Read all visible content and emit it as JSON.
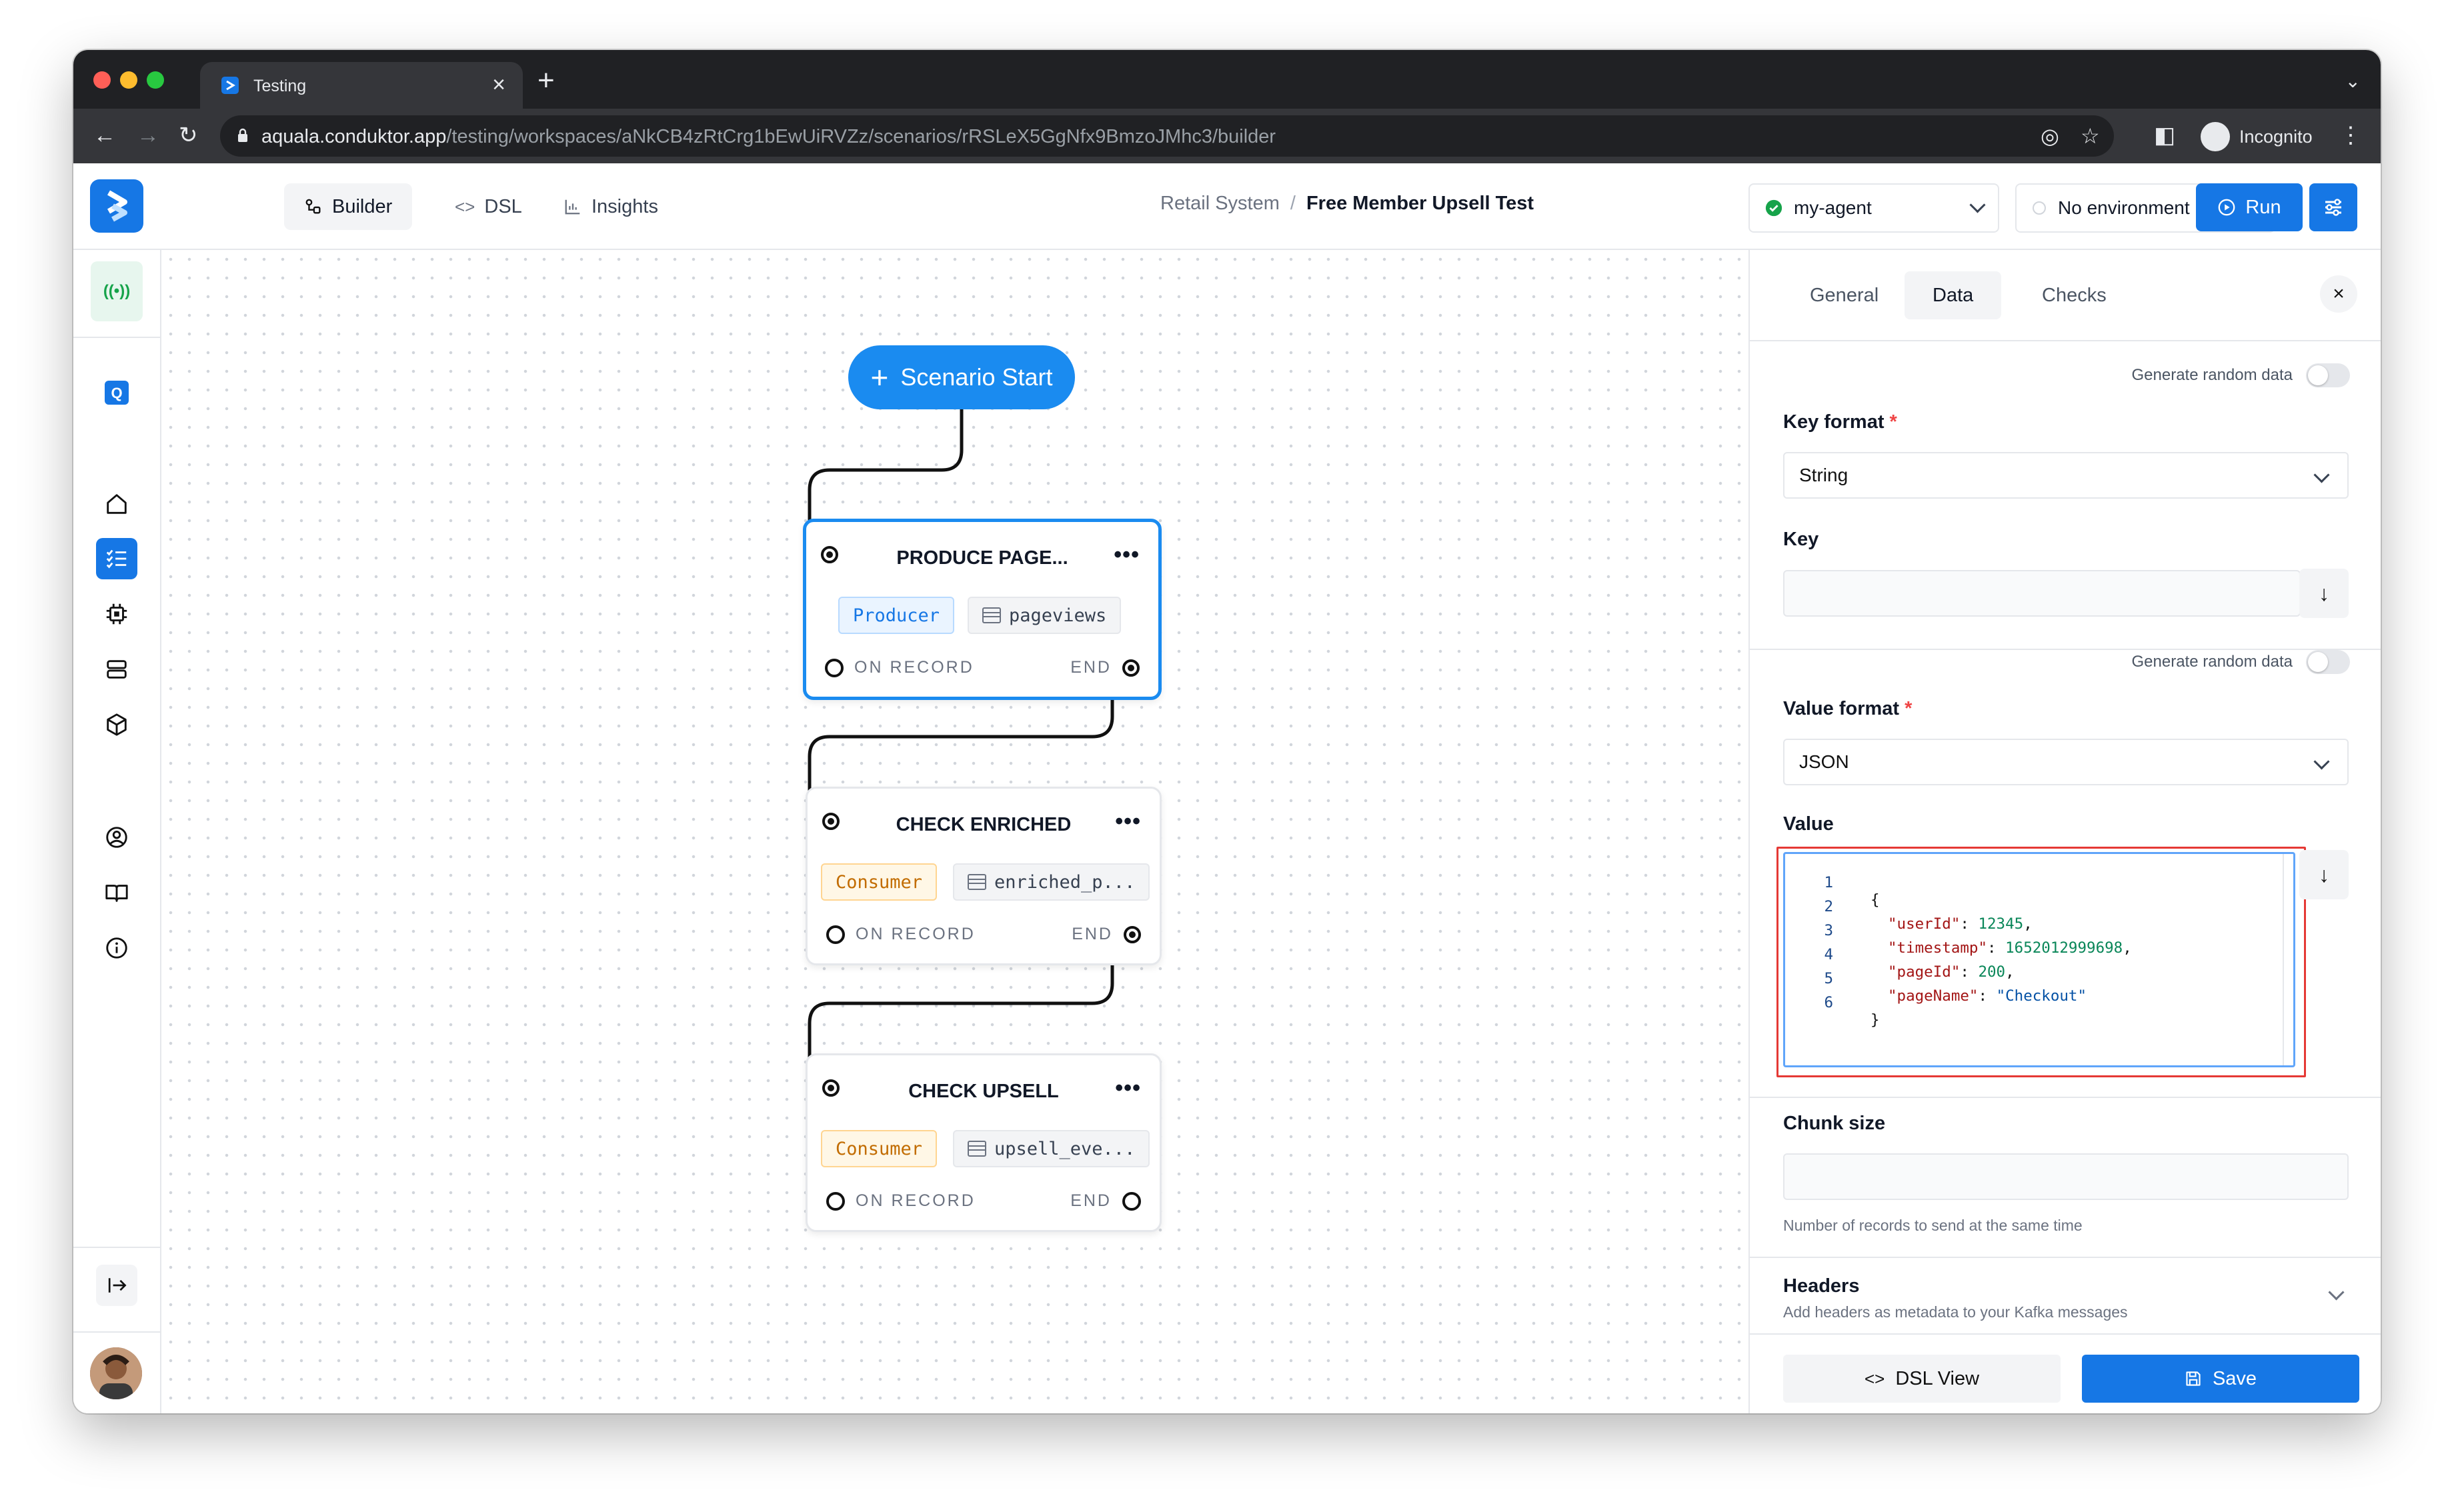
{
  "browser": {
    "tab_title": "Testing",
    "url_host": "aquala.conduktor.app",
    "url_path": "/testing/workspaces/aNkCB4zRtCrg1bEwUiRVZz/scenarios/rRSLeX5GgNfx9BmzoJMhc3/builder",
    "profile_label": "Incognito"
  },
  "topbar": {
    "views": [
      {
        "label": "Builder",
        "icon": "builder-icon",
        "active": true
      },
      {
        "label": "DSL",
        "icon": "code-icon",
        "active": false
      },
      {
        "label": "Insights",
        "icon": "chart-icon",
        "active": false
      }
    ],
    "breadcrumb_parent": "Retail System",
    "breadcrumb_separator": "/",
    "breadcrumb_current": "Free Member Upsell Test",
    "agent": "my-agent",
    "environment": "No environment",
    "run_label": "Run"
  },
  "colors": {
    "primary": "#1677e5",
    "agent_ok": "#16a34a",
    "producer_tag": "#1677e5",
    "consumer_tag": "#c26c00"
  },
  "canvas": {
    "start_label": "Scenario Start",
    "nodes": [
      {
        "title": "PRODUCE PAGE...",
        "role": "Producer",
        "topic": "pageviews",
        "on_record": "ON RECORD",
        "end": "END"
      },
      {
        "title": "CHECK ENRICHED",
        "role": "Consumer",
        "topic": "enriched_p...",
        "on_record": "ON RECORD",
        "end": "END"
      },
      {
        "title": "CHECK UPSELL",
        "role": "Consumer",
        "topic": "upsell_eve...",
        "on_record": "ON RECORD",
        "end": "END"
      }
    ]
  },
  "panel": {
    "tabs": [
      {
        "label": "General",
        "active": false
      },
      {
        "label": "Data",
        "active": true
      },
      {
        "label": "Checks",
        "active": false
      }
    ],
    "key_random_label": "Generate random data",
    "key_format_label": "Key format",
    "key_format_value": "String",
    "key_label": "Key",
    "key_value": "",
    "value_random_label": "Generate random data",
    "value_format_label": "Value format",
    "value_format_value": "JSON",
    "value_label": "Value",
    "value_lines": [
      {
        "num": "1",
        "text": "{"
      },
      {
        "num": "2",
        "key": "\"userId\"",
        "value": "12345",
        "type": "number",
        "comma": ","
      },
      {
        "num": "3",
        "key": "\"timestamp\"",
        "value": "1652012999698",
        "type": "number",
        "comma": ","
      },
      {
        "num": "4",
        "key": "\"pageId\"",
        "value": "200",
        "type": "number",
        "comma": ","
      },
      {
        "num": "5",
        "key": "\"pageName\"",
        "value": "\"Checkout\"",
        "type": "string",
        "comma": ""
      },
      {
        "num": "6",
        "text": "}"
      }
    ],
    "chunk_label": "Chunk size",
    "chunk_value": "",
    "chunk_hint": "Number of records to send at the same time",
    "headers_label": "Headers",
    "headers_hint": "Add headers as metadata to your Kafka messages",
    "dsl_view_label": "DSL View",
    "save_label": "Save"
  }
}
